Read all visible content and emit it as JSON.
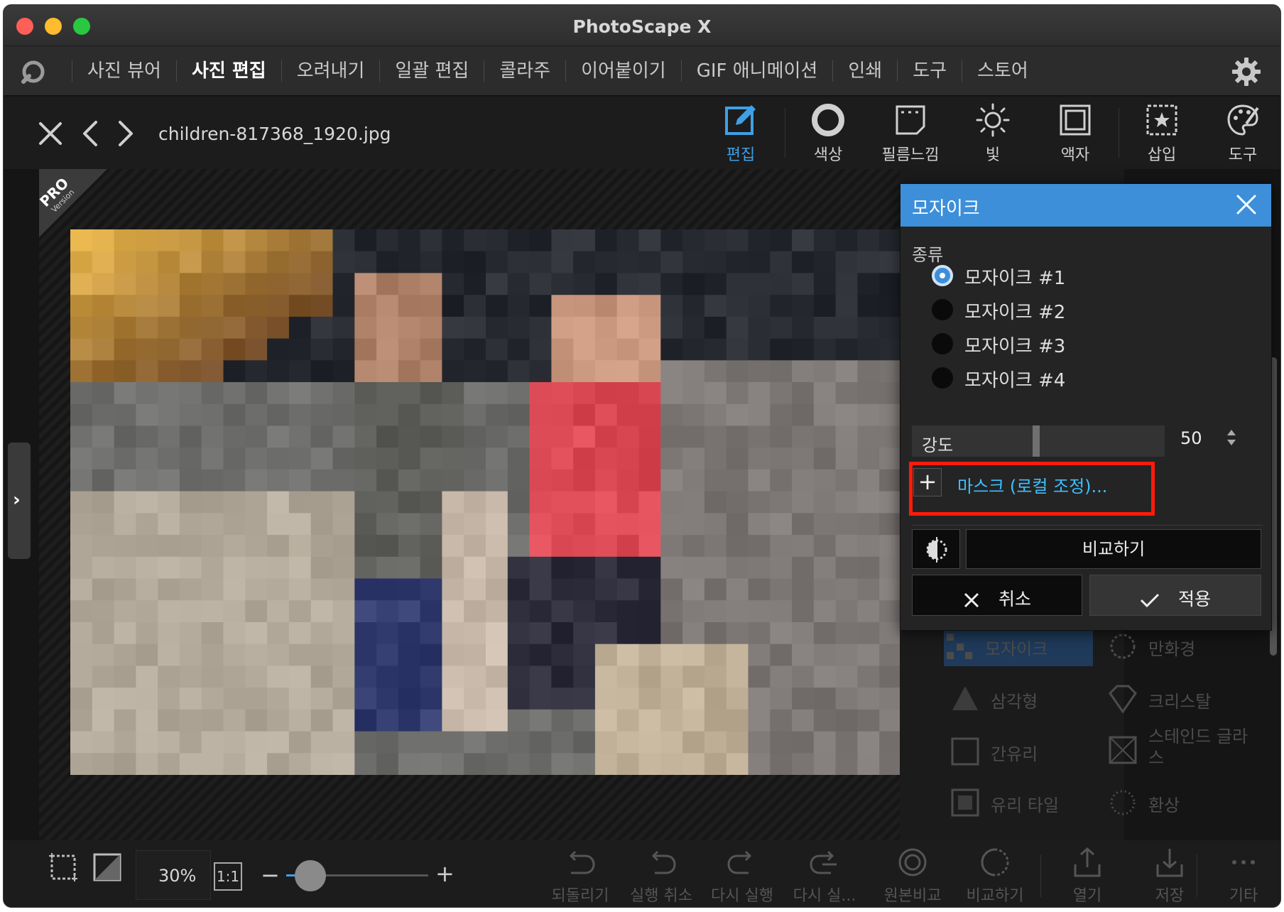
{
  "window": {
    "title": "PhotoScape X"
  },
  "menu": {
    "items": [
      {
        "label": "사진 뷰어"
      },
      {
        "label": "사진 편집"
      },
      {
        "label": "오려내기"
      },
      {
        "label": "일괄 편집"
      },
      {
        "label": "콜라주"
      },
      {
        "label": "이어붙이기"
      },
      {
        "label": "GIF 애니메이션"
      },
      {
        "label": "인쇄"
      },
      {
        "label": "도구"
      },
      {
        "label": "스토어"
      }
    ],
    "active_index": 1
  },
  "toolbar": {
    "filename": "children-817368_1920.jpg",
    "tools": [
      {
        "label": "편집",
        "icon": "edit-icon"
      },
      {
        "label": "색상",
        "icon": "circle-icon"
      },
      {
        "label": "필름느낌",
        "icon": "film-icon"
      },
      {
        "label": "빛",
        "icon": "sun-icon"
      },
      {
        "label": "액자",
        "icon": "frame-icon"
      },
      {
        "label": "삽입",
        "icon": "insert-star-icon"
      },
      {
        "label": "도구",
        "icon": "palette-icon"
      }
    ]
  },
  "badge": {
    "pro": "PRO",
    "version": "Version"
  },
  "effects": {
    "items": [
      {
        "label": "모자이크",
        "icon": "mosaic-icon"
      },
      {
        "label": "만화경",
        "icon": "kaleidoscope-icon"
      },
      {
        "label": "삼각형",
        "icon": "triangle-icon"
      },
      {
        "label": "크리스탈",
        "icon": "crystal-icon"
      },
      {
        "label": "간유리",
        "icon": "frosted-glass-icon"
      },
      {
        "label": "스테인드 글라스",
        "icon": "stained-glass-icon"
      },
      {
        "label": "유리 타일",
        "icon": "glass-tile-icon"
      },
      {
        "label": "환상",
        "icon": "fantasy-icon"
      }
    ]
  },
  "dialog": {
    "title": "모자이크",
    "type_label": "종류",
    "options": [
      {
        "label": "모자이크 #1",
        "checked": true
      },
      {
        "label": "모자이크 #2",
        "checked": false
      },
      {
        "label": "모자이크 #3",
        "checked": false
      },
      {
        "label": "모자이크 #4",
        "checked": false
      }
    ],
    "strength_label": "강도",
    "strength_value": "50",
    "mask_label": "마스크 (로컬 조정)...",
    "compare_label": "비교하기",
    "cancel_label": "취소",
    "apply_label": "적용"
  },
  "bottom": {
    "zoom": "30%",
    "one_to_one": "1:1",
    "actions": [
      {
        "label": "되돌리기",
        "icon": "revert-icon"
      },
      {
        "label": "실행 취소",
        "icon": "undo-icon"
      },
      {
        "label": "다시 실행",
        "icon": "redo-icon"
      },
      {
        "label": "다시 실...",
        "icon": "redo-all-icon"
      },
      {
        "label": "원본비교",
        "icon": "compare-original-icon"
      },
      {
        "label": "비교하기",
        "icon": "compare-icon"
      },
      {
        "label": "열기",
        "icon": "open-icon"
      },
      {
        "label": "저장",
        "icon": "save-icon"
      },
      {
        "label": "기타",
        "icon": "more-icon"
      }
    ]
  },
  "colors": {
    "accent": "#3d8fd9",
    "highlight_box": "#ff1a0a",
    "mask_text": "#3ec0ff"
  }
}
